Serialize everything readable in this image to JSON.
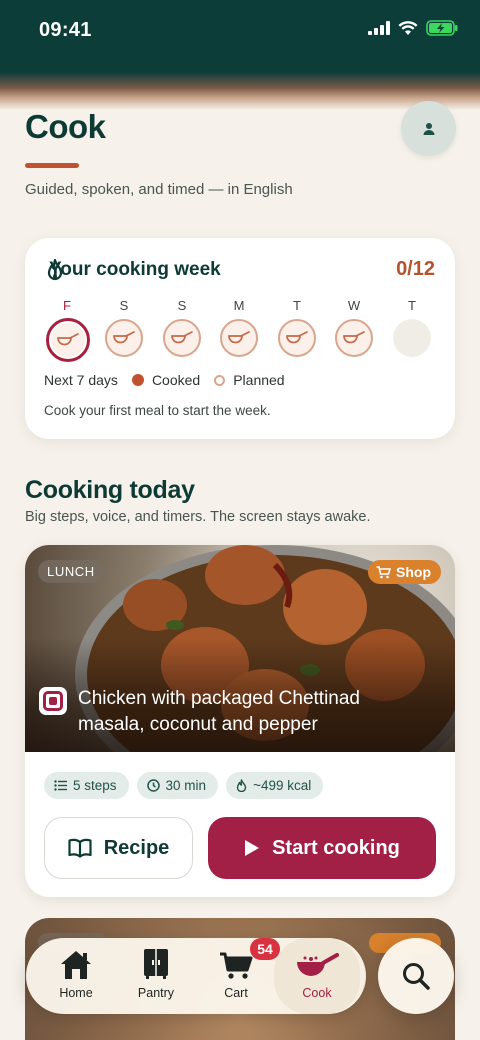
{
  "status_bar": {
    "time": "09:41"
  },
  "header": {
    "title": "Cook",
    "subtitle": "Guided, spoken, and timed — in English"
  },
  "week": {
    "title": "Your cooking week",
    "count": "0/12",
    "days": [
      {
        "label": "F",
        "state": "planned-today"
      },
      {
        "label": "S",
        "state": "planned"
      },
      {
        "label": "S",
        "state": "planned"
      },
      {
        "label": "M",
        "state": "planned"
      },
      {
        "label": "T",
        "state": "planned"
      },
      {
        "label": "W",
        "state": "planned"
      },
      {
        "label": "T",
        "state": "empty"
      }
    ],
    "legend_range": "Next 7 days",
    "legend_cooked": "Cooked",
    "legend_planned": "Planned",
    "note": "Cook your first meal to start the week."
  },
  "today": {
    "title": "Cooking today",
    "subtitle": "Big steps, voice, and timers. The screen stays awake."
  },
  "recipe": {
    "meal": "LUNCH",
    "shop_label": "Shop",
    "name": "Chicken with packaged Chettinad masala, coconut and pepper",
    "steps": "5 steps",
    "time": "30 min",
    "kcal": "~499 kcal",
    "recipe_button": "Recipe",
    "start_button": "Start cooking"
  },
  "tabs": [
    {
      "label": "Home",
      "icon": "home-icon"
    },
    {
      "label": "Pantry",
      "icon": "pantry-icon"
    },
    {
      "label": "Cart",
      "icon": "cart-icon",
      "badge": "54"
    },
    {
      "label": "Cook",
      "icon": "cook-pan-icon",
      "active": true
    }
  ],
  "colors": {
    "brand_dark": "#0e3a36",
    "accent": "#a21f45",
    "orange": "#c0522f",
    "background": "#f6f1ea"
  }
}
